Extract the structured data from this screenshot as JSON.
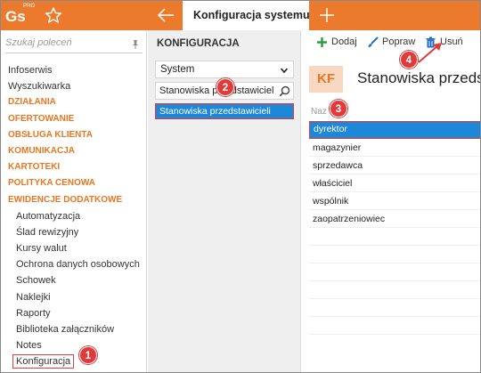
{
  "app": {
    "logo_text": "Gs",
    "logo_badge": "PRO",
    "active_tab": "Konfiguracja systemu",
    "accent_color": "#ec7a2c"
  },
  "sidebar": {
    "search_placeholder": "Szukaj poleceń",
    "items": [
      {
        "label": "Infoserwis",
        "type": "item"
      },
      {
        "label": "Wyszukiwarka",
        "type": "item"
      },
      {
        "label": "DZIAŁANIA",
        "type": "category"
      },
      {
        "label": "OFERTOWANIE",
        "type": "category"
      },
      {
        "label": "OBSŁUGA KLIENTA",
        "type": "category"
      },
      {
        "label": "KOMUNIKACJA",
        "type": "category"
      },
      {
        "label": "KARTOTEKI",
        "type": "category"
      },
      {
        "label": "POLITYKA CENOWA",
        "type": "category"
      },
      {
        "label": "EWIDENCJE DODATKOWE",
        "type": "category"
      },
      {
        "label": "Automatyzacja",
        "type": "sub"
      },
      {
        "label": "Ślad rewizyjny",
        "type": "sub"
      },
      {
        "label": "Kursy walut",
        "type": "sub"
      },
      {
        "label": "Ochrona danych osobowych",
        "type": "sub"
      },
      {
        "label": "Schowek",
        "type": "sub"
      },
      {
        "label": "Naklejki",
        "type": "sub"
      },
      {
        "label": "Raporty",
        "type": "sub"
      },
      {
        "label": "Biblioteka załączników",
        "type": "sub"
      },
      {
        "label": "Notes",
        "type": "sub"
      },
      {
        "label": "Konfiguracja",
        "type": "sub-selected"
      }
    ]
  },
  "middle": {
    "title": "KONFIGURACJA",
    "select_value": "System",
    "filter_value": "Stanowiska przedstawicieli",
    "selected_item": "Stanowiska przedstawicieli"
  },
  "right": {
    "toolbar": {
      "add_label": "Dodaj",
      "edit_label": "Popraw",
      "delete_label": "Usuń"
    },
    "avatar_text": "KF",
    "title": "Stanowiska przeds",
    "column_header": "Naz",
    "rows": [
      "dyrektor",
      "magazynier",
      "sprzedawca",
      "właściciel",
      "wspólnik",
      "zaopatrzeniowiec"
    ]
  },
  "callouts": [
    "1",
    "2",
    "3",
    "4"
  ],
  "colors": {
    "selection_blue": "#1e88d8",
    "callout_red": "#e03a3a",
    "category_orange": "#e87722"
  }
}
